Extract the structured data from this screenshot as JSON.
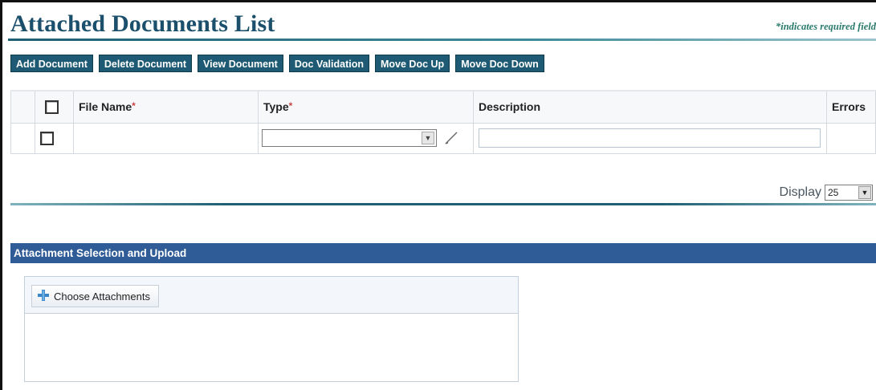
{
  "header": {
    "title": "Attached Documents List",
    "required_note": "*indicates required field"
  },
  "toolbar": {
    "buttons": [
      {
        "label": "Add Document"
      },
      {
        "label": "Delete Document"
      },
      {
        "label": "View Document"
      },
      {
        "label": "Doc Validation"
      },
      {
        "label": "Move Doc Up"
      },
      {
        "label": "Move Doc Down"
      }
    ]
  },
  "grid": {
    "columns": {
      "file_name": "File Name",
      "type": "Type",
      "description": "Description",
      "errors": "Errors"
    },
    "required_marker": "*",
    "rows": [
      {
        "file_name": "",
        "type": "",
        "description": "",
        "errors": ""
      }
    ]
  },
  "pagination": {
    "display_label": "Display",
    "display_value": "25"
  },
  "upload": {
    "section_title": "Attachment Selection and Upload",
    "choose_label": "Choose Attachments"
  },
  "icons": {
    "plus": "plus-icon",
    "pencil": "pencil-icon",
    "dropdown": "chevron-down-icon"
  },
  "colors": {
    "title": "#1b4f6b",
    "toolbar_button": "#1e5a73",
    "section_bar": "#2f5b96",
    "required_note": "#2a7a6c"
  }
}
